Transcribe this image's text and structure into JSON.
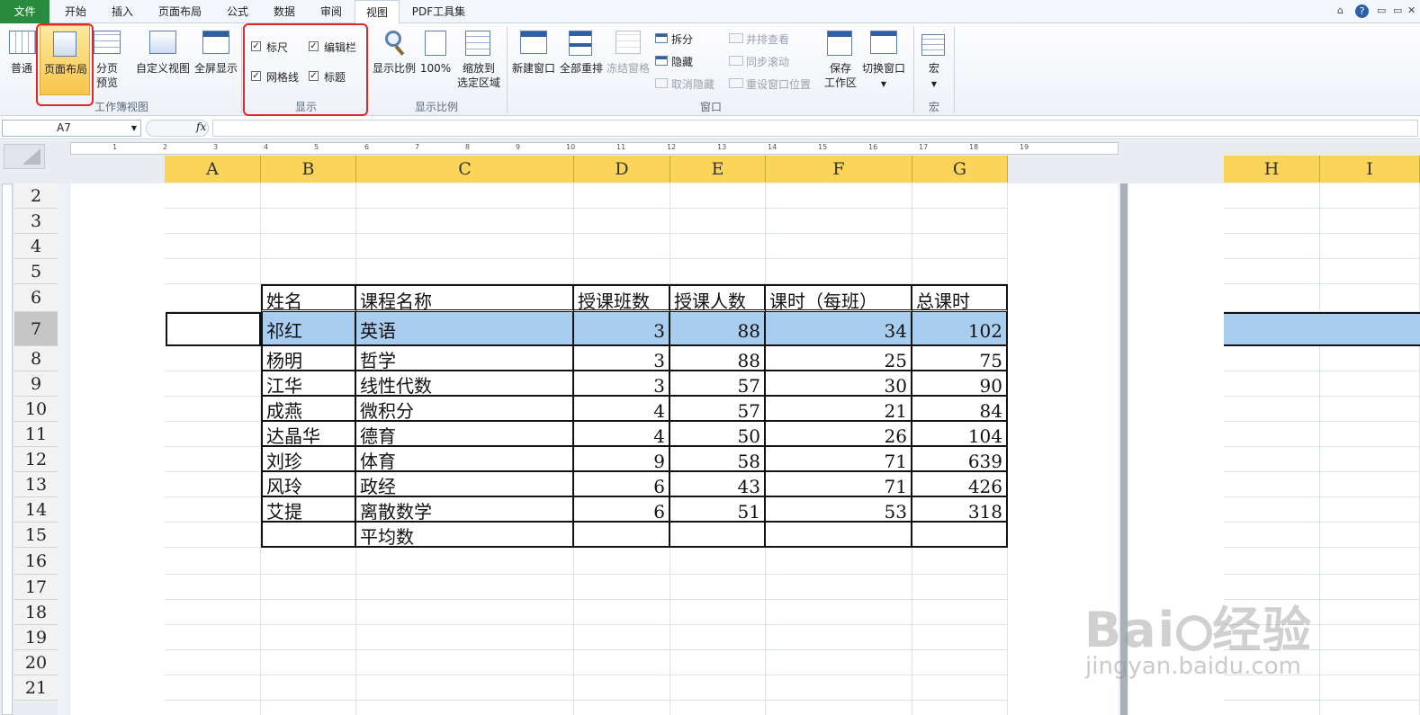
{
  "tabs": [
    "文件",
    "开始",
    "插入",
    "页面布局",
    "公式",
    "数据",
    "审阅",
    "视图",
    "PDF工具集"
  ],
  "window_controls": [
    "⌂",
    "?",
    "▭",
    "▭",
    "✕"
  ],
  "ribbon": {
    "workbook_views": {
      "normal": "普通",
      "page_layout": "页面布局",
      "page_break_1": "分页",
      "page_break_2": "预览",
      "custom_view": "自定义视图",
      "full_screen": "全屏显示",
      "group": "工作簿视图"
    },
    "show": {
      "ruler": "标尺",
      "formula_bar": "编辑栏",
      "gridlines": "网格线",
      "headings": "标题",
      "group": "显示"
    },
    "zoom": {
      "zoom": "显示比例",
      "hundred": "100%",
      "to_sel_1": "缩放到",
      "to_sel_2": "选定区域",
      "group": "显示比例"
    },
    "window": {
      "new_window": "新建窗口",
      "arrange_all": "全部重排",
      "freeze": "冻结窗格",
      "split": "拆分",
      "hide": "隐藏",
      "unhide": "取消隐藏",
      "side_by_side": "并排查看",
      "sync_scroll": "同步滚动",
      "reset_pos": "重设窗口位置",
      "save_ws_1": "保存",
      "save_ws_2": "工作区",
      "switch": "切换窗口",
      "group": "窗口"
    },
    "macros": {
      "macro": "宏",
      "group": "宏"
    }
  },
  "formula_bar": {
    "name_box": "A7",
    "fx": "fx",
    "value": ""
  },
  "ruler": [
    "1",
    "2",
    "3",
    "4",
    "5",
    "6",
    "7",
    "8",
    "9",
    "10",
    "11",
    "12",
    "13",
    "14",
    "15",
    "16",
    "17",
    "18",
    "19"
  ],
  "columns": [
    "A",
    "B",
    "C",
    "D",
    "E",
    "F",
    "G",
    "H",
    "I"
  ],
  "rows": [
    "2",
    "3",
    "4",
    "5",
    "6",
    "7",
    "8",
    "9",
    "10",
    "11",
    "12",
    "13",
    "14",
    "15",
    "16",
    "17",
    "18",
    "19",
    "20",
    "21"
  ],
  "table": {
    "header": [
      "姓名",
      "课程名称",
      "授课班数",
      "授课人数",
      "课时（每班）",
      "总课时"
    ],
    "rows": [
      [
        "祁红",
        "英语",
        "3",
        "88",
        "34",
        "102"
      ],
      [
        "杨明",
        "哲学",
        "3",
        "88",
        "25",
        "75"
      ],
      [
        "江华",
        "线性代数",
        "3",
        "57",
        "30",
        "90"
      ],
      [
        "成燕",
        "微积分",
        "4",
        "57",
        "21",
        "84"
      ],
      [
        "达晶华",
        "德育",
        "4",
        "50",
        "26",
        "104"
      ],
      [
        "刘珍",
        "体育",
        "9",
        "58",
        "71",
        "639"
      ],
      [
        "风玲",
        "政经",
        "6",
        "43",
        "71",
        "426"
      ],
      [
        "艾提",
        "离散数学",
        "6",
        "51",
        "53",
        "318"
      ],
      [
        "",
        "平均数",
        "",
        "",
        "",
        ""
      ]
    ]
  },
  "watermark": {
    "brand": "Bai",
    "cn": "经验",
    "url": "jingyan.baidu.com"
  }
}
